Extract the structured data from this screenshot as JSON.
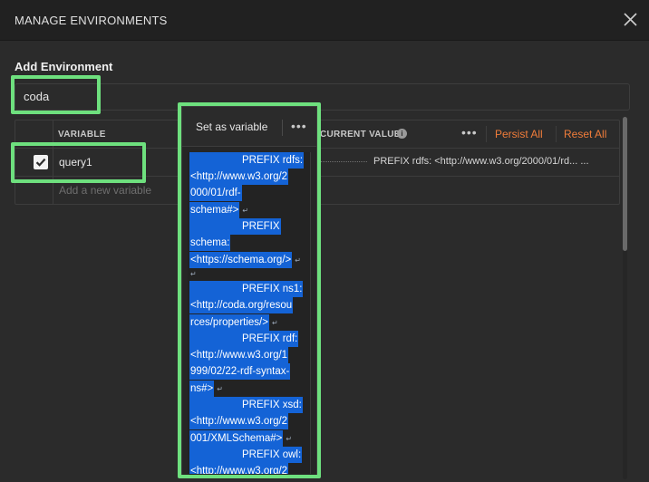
{
  "window": {
    "title": "MANAGE ENVIRONMENTS"
  },
  "form": {
    "section_title": "Add Environment",
    "name_value": "coda"
  },
  "table": {
    "columns": {
      "variable": "VARIABLE",
      "current_value": "CURRENT VALUE"
    },
    "actions": {
      "persist_all": "Persist All",
      "reset_all": "Reset All",
      "more": "•••"
    },
    "rows": [
      {
        "enabled": true,
        "name": "query1",
        "current_value": "PREFIX rdfs: <http://www.w3.org/2000/01/rd... ..."
      }
    ],
    "new_variable_placeholder": "Add a new variable"
  },
  "popup": {
    "set_as_variable": "Set as variable",
    "more": "•••",
    "editor_lines": [
      {
        "lines": [
          "PREFIX rdfs:",
          "<http://www.w3.org/2",
          "000/01/rdf-",
          "schema#>"
        ],
        "first_right": true
      },
      {
        "lines": [
          "PREFIX",
          "schema:",
          "<https://schema.org/>"
        ],
        "first_right": true
      },
      {
        "lines": [
          "PREFIX ns1:",
          "<http://coda.org/resou",
          "rces/properties/>"
        ],
        "first_right": true
      },
      {
        "lines": [
          "PREFIX rdf:",
          "<http://www.w3.org/1",
          "999/02/22-rdf-syntax-",
          "ns#>"
        ],
        "first_right": true
      },
      {
        "lines": [
          "PREFIX xsd:",
          "<http://www.w3.org/2",
          "001/XMLSchema#>"
        ],
        "first_right": true
      },
      {
        "lines": [
          "PREFIX owl:",
          "<http://www.w3.org/2"
        ],
        "first_right": true
      }
    ]
  },
  "colors": {
    "accent_orange": "#f07c3a",
    "highlight_green": "#6ee07e",
    "selection_blue": "#1463d6"
  }
}
